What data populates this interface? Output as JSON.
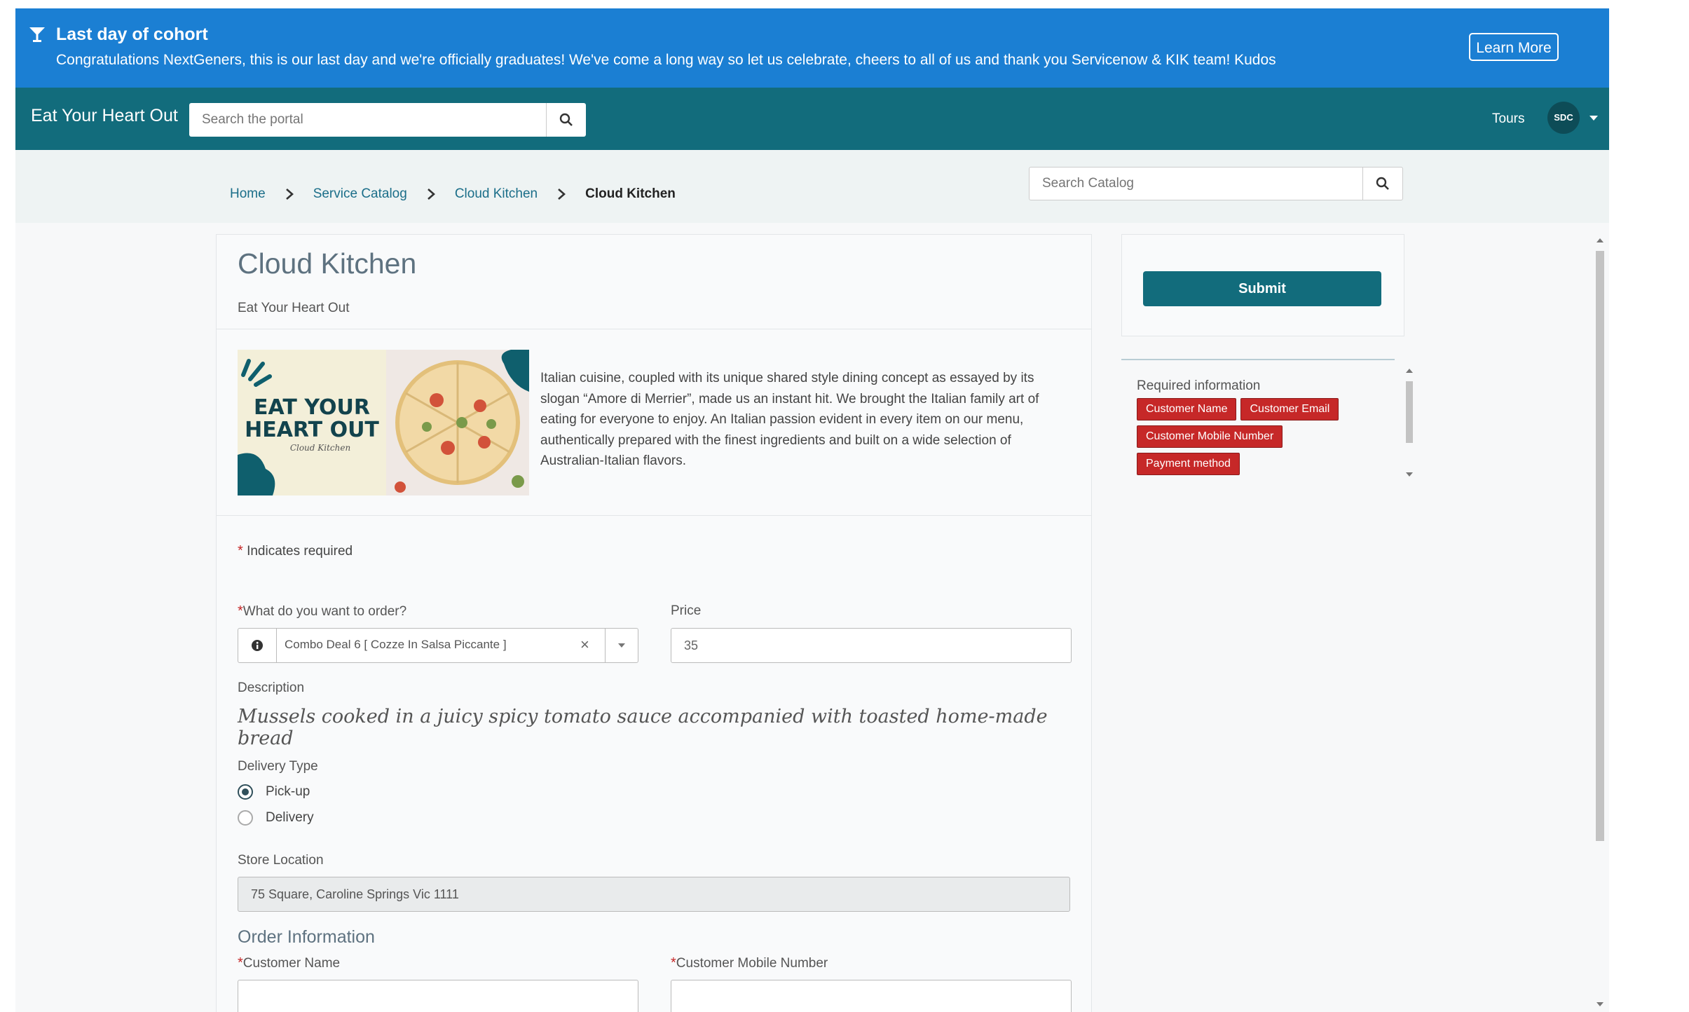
{
  "banner": {
    "title": "Last day of cohort",
    "message": "Congratulations NextGeners, this is our last day and we're officially graduates! We've come a long way so let us celebrate, cheers to all of us and thank you Servicenow & KIK team! Kudos",
    "button_label": "Learn More",
    "icon": "cocktail-glass-icon",
    "color": "#1b7fd3"
  },
  "header": {
    "brand": "Eat Your Heart Out",
    "search_placeholder": "Search the portal",
    "tours_label": "Tours",
    "avatar_initials": "SDC",
    "color": "#126c7c"
  },
  "breadcrumb": {
    "items": [
      "Home",
      "Service Catalog",
      "Cloud Kitchen"
    ],
    "current": "Cloud Kitchen"
  },
  "catalog_search": {
    "placeholder": "Search Catalog"
  },
  "item": {
    "title": "Cloud Kitchen",
    "subtitle": "Eat Your Heart Out",
    "hero_text": {
      "line1": "EAT YOUR",
      "line2": "HEART OUT",
      "script": "Cloud Kitchen"
    },
    "intro": "Italian cuisine, coupled with its unique shared style dining concept as essayed by its slogan “Amore di Merrier”, made us an instant hit. We brought the Italian family art of eating for everyone to enjoy. An Italian passion evident in every item on our menu, authentically prepared with the finest ingredients and built on a wide selection of Australian-Italian flavors."
  },
  "form": {
    "required_note": "Indicates required",
    "order_label": "What do you want to order?",
    "order_value": "Combo Deal 6 [ Cozze In Salsa Piccante ]",
    "price_label": "Price",
    "price_value": "35",
    "description_label": "Description",
    "description_value": "Mussels cooked in a juicy spicy tomato sauce accompanied with toasted home-made bread",
    "delivery_label": "Delivery Type",
    "delivery_options": [
      {
        "label": "Pick-up",
        "selected": true
      },
      {
        "label": "Delivery",
        "selected": false
      }
    ],
    "store_label": "Store Location",
    "store_value": "75 Square, Caroline Springs Vic 1111",
    "order_info_heading": "Order Information",
    "customer_name_label": "Customer Name",
    "customer_mobile_label": "Customer Mobile Number"
  },
  "sidebar": {
    "submit_label": "Submit",
    "required_title": "Required information",
    "required_tags": [
      "Customer Name",
      "Customer Email",
      "Customer Mobile Number",
      "Payment method"
    ],
    "tag_color": "#c62828"
  }
}
